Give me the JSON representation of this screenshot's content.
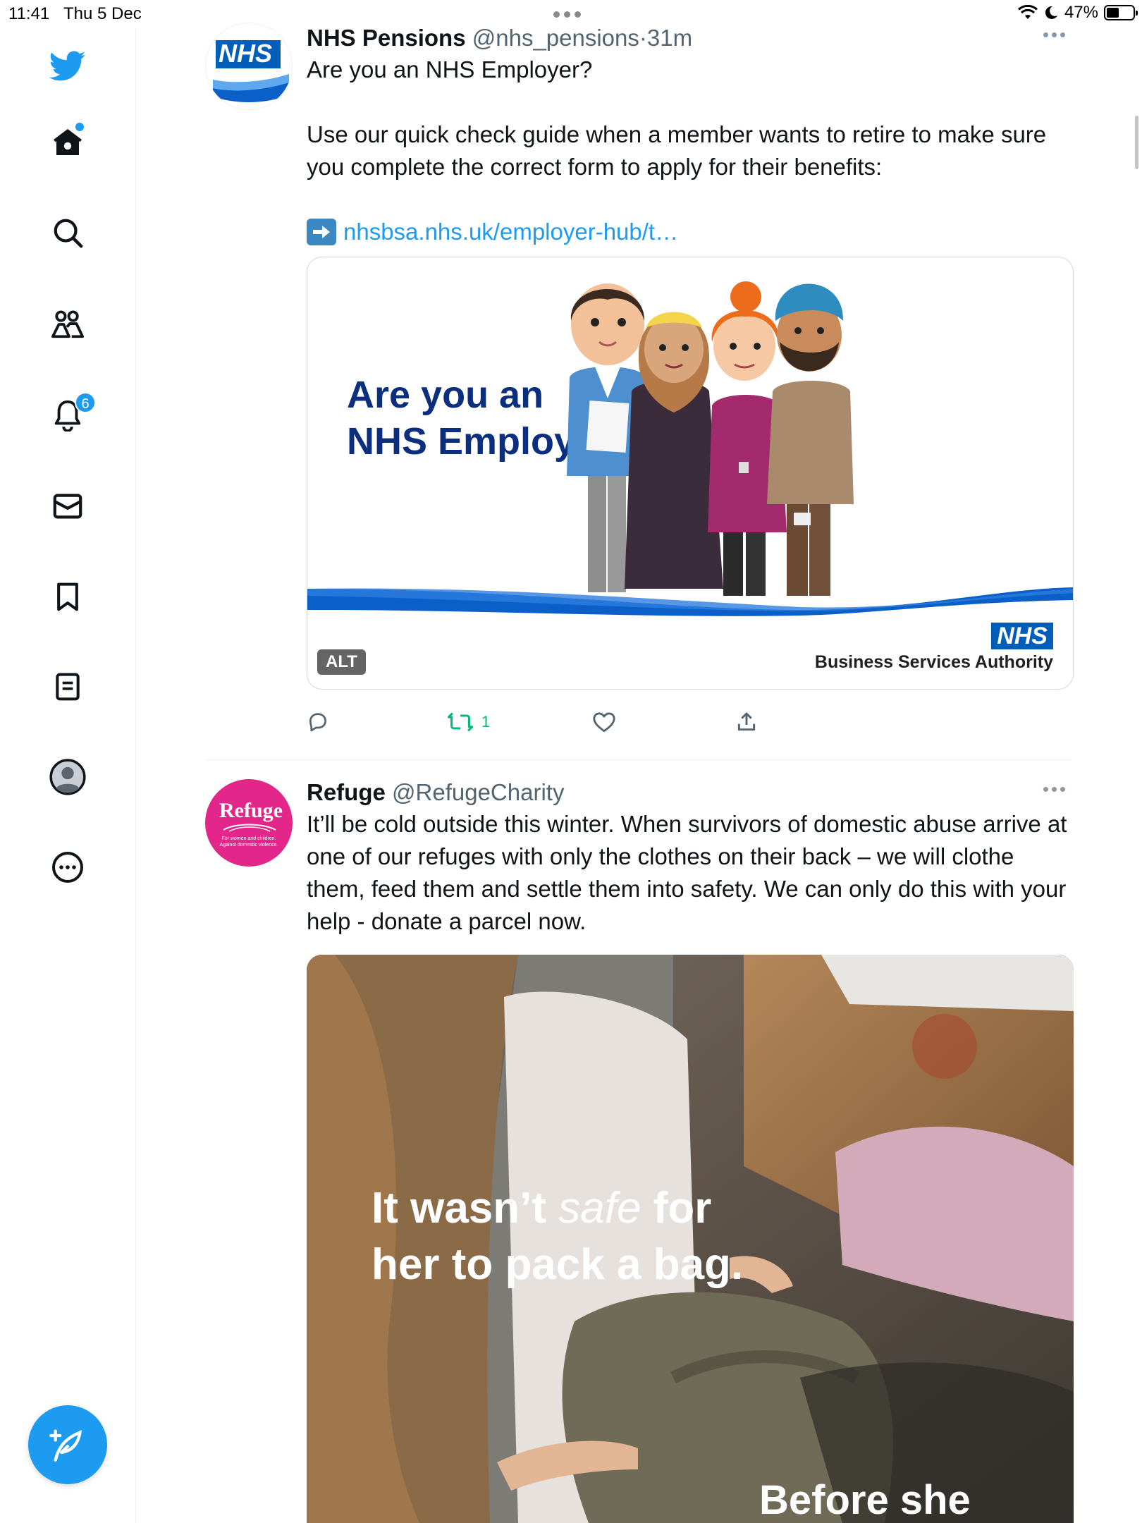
{
  "status_bar": {
    "time": "11:41",
    "date": "Thu 5 Dec",
    "battery": "47%",
    "battery_level": 0.47
  },
  "sidebar": {
    "items": [
      {
        "name": "home"
      },
      {
        "name": "explore"
      },
      {
        "name": "communities"
      },
      {
        "name": "notifications",
        "badge": "6"
      },
      {
        "name": "messages"
      },
      {
        "name": "bookmarks"
      },
      {
        "name": "lists"
      },
      {
        "name": "profile"
      },
      {
        "name": "more"
      }
    ],
    "accent": "#1d9bf0"
  },
  "tweets": [
    {
      "name": "NHS Pensions",
      "handle": "@nhs_pensions",
      "sep": "·",
      "time": "31m",
      "text1": "Are you an NHS Employer?",
      "text2": "Use our quick check guide when a member wants to retire to make sure you complete the correct form to apply for their benefits:",
      "link": "nhsbsa.nhs.uk/employer-hub/t…",
      "card": {
        "title_line1": "Are you an",
        "title_line2": "NHS Employer?",
        "alt": "ALT",
        "logo": "NHS",
        "org": "Business Services Authority"
      },
      "avatar_text": "NHS",
      "retweets": "1"
    },
    {
      "name": "Refuge",
      "handle": "@RefugeCharity",
      "text": "It’ll be cold outside this winter. When survivors of domestic abuse arrive at one of our refuges with only the clothes on their back – we will clothe them, feed them and settle them into safety. We can only do this with your help - donate a parcel now.",
      "avatar_text": "Refuge",
      "avatar_sub": "For women and children. Against domestic violence.",
      "photo": {
        "line1_a": "It wasn’t ",
        "line1_b": "safe",
        "line1_c": " for",
        "line2": "her to pack a bag.",
        "line3": "Before she"
      }
    }
  ]
}
